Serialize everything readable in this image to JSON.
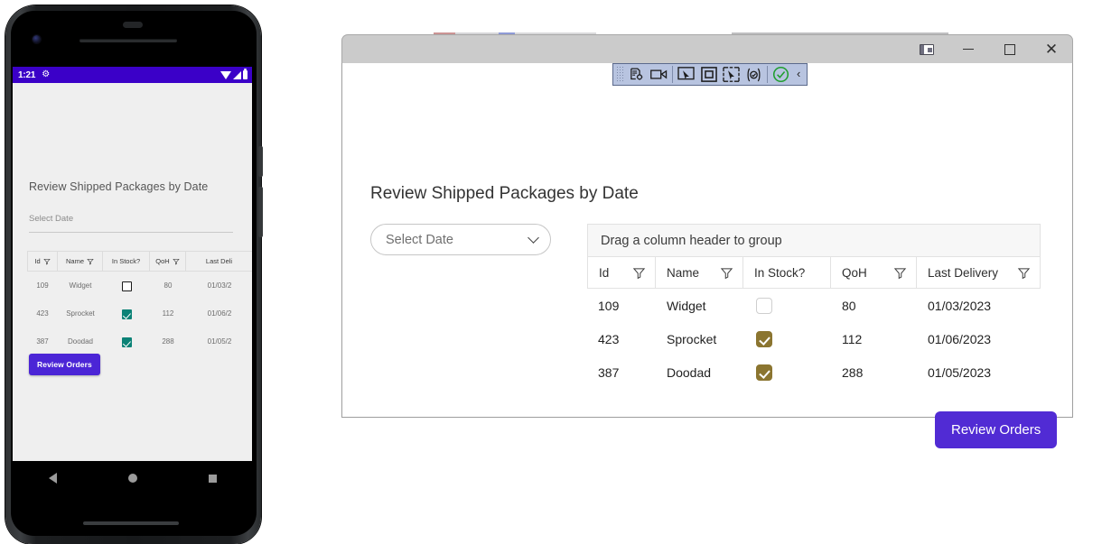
{
  "phone": {
    "status_bar": {
      "time": "1:21",
      "gear_icon": "gear-icon",
      "wifi_icon": "wifi-icon",
      "signal_icon": "cell-signal-icon",
      "battery_icon": "battery-icon"
    },
    "title": "Review Shipped Packages by Date",
    "date_field": {
      "placeholder": "Select Date"
    },
    "grid": {
      "columns": [
        "Id",
        "Name",
        "In Stock?",
        "QoH",
        "Last Deli"
      ],
      "rows": [
        {
          "id": "109",
          "name": "Widget",
          "in_stock": false,
          "qoh": "80",
          "last_delivery": "01/03/2"
        },
        {
          "id": "423",
          "name": "Sprocket",
          "in_stock": true,
          "qoh": "112",
          "last_delivery": "01/06/2"
        },
        {
          "id": "387",
          "name": "Doodad",
          "in_stock": true,
          "qoh": "288",
          "last_delivery": "01/05/2"
        }
      ]
    },
    "review_button": "Review Orders",
    "nav": {
      "back": "back-icon",
      "home": "home-icon",
      "recents": "recents-icon"
    }
  },
  "window": {
    "title": "",
    "controls": {
      "dock": "dock-layout-icon",
      "minimize": "minimize-icon",
      "maximize": "maximize-icon",
      "close": "close-icon"
    }
  },
  "recorder_toolbar": {
    "buttons": [
      {
        "name": "record-steps-icon",
        "label": ""
      },
      {
        "name": "record-video-icon",
        "label": ""
      },
      {
        "name": "select-pointer-icon",
        "label": ""
      },
      {
        "name": "select-element-icon",
        "label": ""
      },
      {
        "name": "select-region-icon",
        "label": ""
      },
      {
        "name": "add-assertion-icon",
        "label": "{⊘}"
      },
      {
        "name": "verify-success-icon",
        "label": ""
      },
      {
        "name": "collapse-toolbar-icon",
        "label": "‹"
      }
    ]
  },
  "app": {
    "title": "Review Shipped Packages by Date",
    "date_select": {
      "value": "Select Date"
    },
    "grid": {
      "group_hint": "Drag a column header to group",
      "columns": [
        {
          "label": "Id",
          "filter": true
        },
        {
          "label": "Name",
          "filter": true
        },
        {
          "label": "In Stock?",
          "filter": false
        },
        {
          "label": "QoH",
          "filter": true
        },
        {
          "label": "Last Delivery",
          "filter": true
        }
      ],
      "rows": [
        {
          "id": "109",
          "name": "Widget",
          "in_stock": false,
          "qoh": "80",
          "last_delivery": "01/03/2023"
        },
        {
          "id": "423",
          "name": "Sprocket",
          "in_stock": true,
          "qoh": "112",
          "last_delivery": "01/06/2023"
        },
        {
          "id": "387",
          "name": "Doodad",
          "in_stock": true,
          "qoh": "288",
          "last_delivery": "01/05/2023"
        }
      ]
    },
    "review_button": "Review Orders"
  },
  "colors": {
    "phone_status_bar": "#3b00c8",
    "phone_accent": "#4b25d6",
    "phone_checkbox": "#0b8276",
    "app_accent": "#512bd4",
    "app_checkbox": "#8b7530",
    "toolbar_bg": "#b8c4e0",
    "titlebar_bg": "#cbcbcb"
  }
}
